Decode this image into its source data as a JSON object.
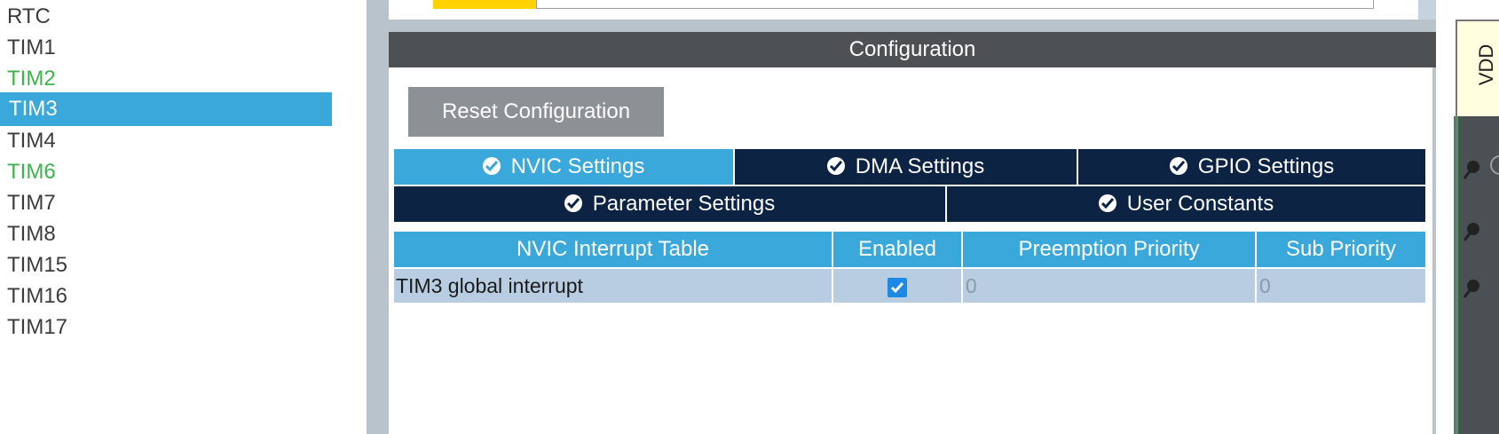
{
  "peripheral_list": {
    "items": [
      {
        "label": "RTC",
        "state": "normal"
      },
      {
        "label": "TIM1",
        "state": "normal"
      },
      {
        "label": "TIM2",
        "state": "configured"
      },
      {
        "label": "TIM3",
        "state": "selected"
      },
      {
        "label": "TIM4",
        "state": "normal"
      },
      {
        "label": "TIM6",
        "state": "configured"
      },
      {
        "label": "TIM7",
        "state": "normal"
      },
      {
        "label": "TIM8",
        "state": "normal"
      },
      {
        "label": "TIM15",
        "state": "normal"
      },
      {
        "label": "TIM16",
        "state": "normal"
      },
      {
        "label": "TIM17",
        "state": "normal"
      }
    ]
  },
  "config": {
    "header_title": "Configuration",
    "reset_button_label": "Reset Configuration",
    "tabs": [
      {
        "label": "NVIC Settings",
        "icon": "check-circle-icon",
        "active": true
      },
      {
        "label": "DMA Settings",
        "icon": "check-circle-icon",
        "active": false
      },
      {
        "label": "GPIO Settings",
        "icon": "check-circle-icon",
        "active": false
      },
      {
        "label": "Parameter Settings",
        "icon": "check-circle-icon",
        "active": false
      },
      {
        "label": "User Constants",
        "icon": "check-circle-icon",
        "active": false
      }
    ]
  },
  "nvic_table": {
    "columns": [
      "NVIC Interrupt Table",
      "Enabled",
      "Preemption Priority",
      "Sub Priority"
    ],
    "rows": [
      {
        "name": "TIM3 global interrupt",
        "enabled": true,
        "preemption_priority": "0",
        "sub_priority": "0"
      }
    ]
  },
  "mcu_view": {
    "pin_label": "VDD"
  },
  "colors": {
    "selected_bg": "#3aa8da",
    "configured_text": "#3cb44b",
    "tab_dark": "#0c2344",
    "header_dark": "#4d5153",
    "table_row_bg": "#b8cde2"
  }
}
